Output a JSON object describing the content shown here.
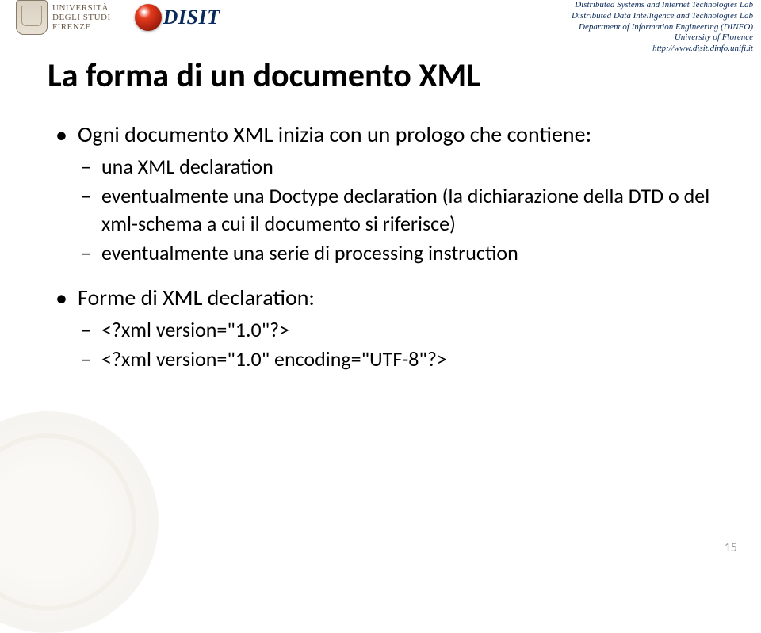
{
  "header": {
    "uni": {
      "line1": "UNIVERSITÀ",
      "line2": "DEGLI STUDI",
      "line3": "FIRENZE"
    },
    "disit": "DISIT",
    "right": {
      "line1": "Distributed Systems and Internet Technologies Lab",
      "line2": "Distributed Data Intelligence and Technologies Lab",
      "line3": "Department of Information Engineering (DINFO)",
      "line4": "University of Florence",
      "line5": "http://www.disit.dinfo.unifi.it"
    }
  },
  "title": "La forma di un documento XML",
  "bullets": {
    "b1": "Ogni documento XML inizia con un prologo che contiene:",
    "b1_1": "una XML declaration",
    "b1_2": "eventualmente una Doctype declaration (la dichiarazione della DTD o del xml-schema a cui il documento si riferisce)",
    "b1_3": "eventualmente una serie di processing instruction",
    "b2": "Forme di XML declaration:",
    "b2_1": "<?xml version=\"1.0\"?>",
    "b2_2": "<?xml version=\"1.0\" encoding=\"UTF-8\"?>"
  },
  "page_number": "15"
}
